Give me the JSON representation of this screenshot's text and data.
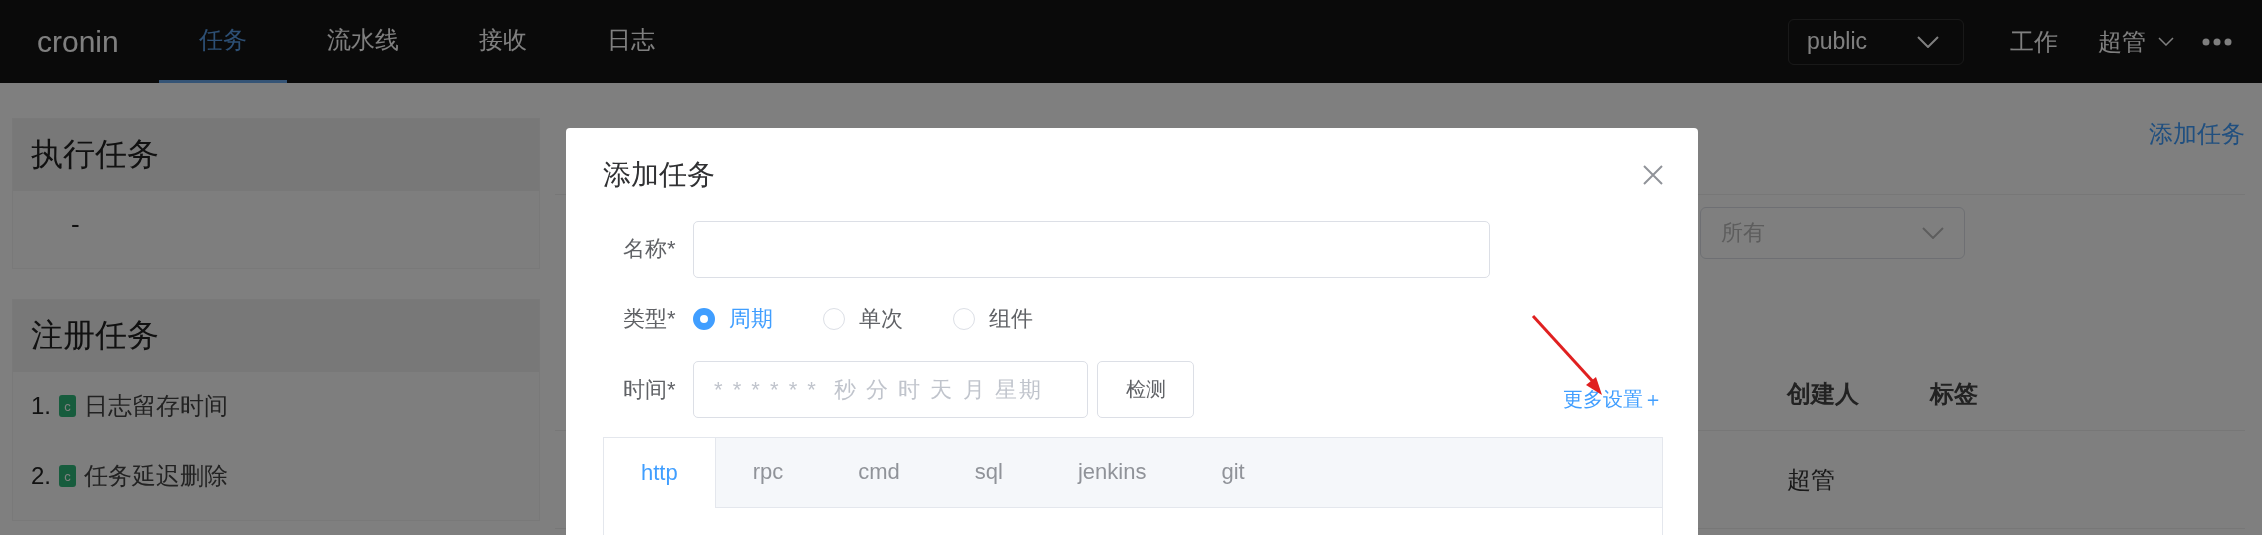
{
  "navbar": {
    "logo": "cronin",
    "tabs": [
      {
        "label": "任务",
        "selected": true
      },
      {
        "label": "流水线",
        "selected": false
      },
      {
        "label": "接收",
        "selected": false
      },
      {
        "label": "日志",
        "selected": false
      }
    ],
    "env_select": {
      "value": "public"
    },
    "work_link": "工作",
    "user": "超管"
  },
  "sidebar": {
    "cards": [
      {
        "title": "执行任务",
        "empty": "-"
      },
      {
        "title": "注册任务",
        "items": [
          {
            "number": "1.",
            "tag": "c",
            "label": "日志留存时间"
          },
          {
            "number": "2.",
            "tag": "c",
            "label": "任务延迟删除"
          }
        ]
      }
    ]
  },
  "main": {
    "add_link": "添加任务",
    "filter": {
      "value": "所有"
    },
    "table": {
      "columns": [
        "创建人",
        "标签"
      ],
      "rows": [
        [
          "超管",
          ""
        ]
      ]
    }
  },
  "dialog": {
    "title": "添加任务",
    "name_field": {
      "label": "名称*"
    },
    "type_field": {
      "label": "类型*",
      "options": [
        {
          "label": "周期",
          "selected": true
        },
        {
          "label": "单次",
          "selected": false
        },
        {
          "label": "组件",
          "selected": false
        }
      ]
    },
    "time_field": {
      "label": "时间*",
      "placeholder": "* * * * * *  秒 分 时 天 月 星期",
      "check_button": "检测"
    },
    "more_link": "更多设置＋",
    "tabs": [
      {
        "label": "http",
        "selected": true
      },
      {
        "label": "rpc",
        "selected": false
      },
      {
        "label": "cmd",
        "selected": false
      },
      {
        "label": "sql",
        "selected": false
      },
      {
        "label": "jenkins",
        "selected": false
      },
      {
        "label": "git",
        "selected": false
      }
    ]
  }
}
